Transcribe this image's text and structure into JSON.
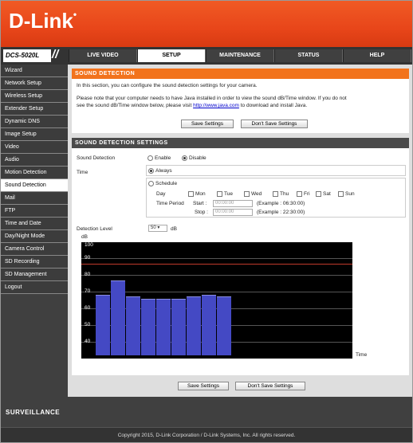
{
  "brand": {
    "logo": "D-Link",
    "model": "DCS-5020L",
    "footer_brand": "SURVEILLANCE"
  },
  "nav": {
    "tabs": [
      "LIVE VIDEO",
      "SETUP",
      "MAINTENANCE",
      "STATUS",
      "HELP"
    ],
    "active": "SETUP"
  },
  "sidebar": {
    "items": [
      "Wizard",
      "Network Setup",
      "Wireless Setup",
      "Extender Setup",
      "Dynamic DNS",
      "Image Setup",
      "Video",
      "Audio",
      "Motion Detection",
      "Sound Detection",
      "Mail",
      "FTP",
      "Time and Date",
      "Day/Night Mode",
      "Camera Control",
      "SD Recording",
      "SD Management",
      "Logout"
    ],
    "active": "Sound Detection"
  },
  "intro": {
    "title": "SOUND DETECTION",
    "line1": "In this section, you can configure the sound detection settings for your camera.",
    "line2": "Please note that your computer needs to have Java installed in order to view the sound dB/Time window. If you do not",
    "line3a": "see the sound dB/Time window below, please visit",
    "link": "http://www.java.com",
    "line3b": "to download and install Java.",
    "save": "Save Settings",
    "dont_save": "Don't Save Settings"
  },
  "settings": {
    "title": "SOUND DETECTION SETTINGS",
    "sd_label": "Sound Detection",
    "enable": "Enable",
    "disable": "Disable",
    "time_label": "Time",
    "always": "Always",
    "schedule": "Schedule",
    "day_label": "Day",
    "days": [
      "Mon",
      "Tue",
      "Wed",
      "Thu",
      "Fri",
      "Sat",
      "Sun"
    ],
    "time_period": "Time Period",
    "start": "Start :",
    "start_ph": "00:00:00",
    "start_ex": "(Example : 06:30:00)",
    "stop": "Stop :",
    "stop_ph": "00:00:00",
    "stop_ex": "(Example : 22:30:00)",
    "level_label": "Detection Level",
    "level_value": "50",
    "level_unit": "dB"
  },
  "chart_data": {
    "type": "bar",
    "ylabel": "dB",
    "xlabel": "Time",
    "ylim": [
      40,
      100
    ],
    "yticks": [
      "100",
      "90",
      "80",
      "70",
      "60",
      "50",
      "40"
    ],
    "threshold": 90,
    "values": [
      73,
      81,
      72,
      71,
      71,
      71,
      72,
      73,
      72
    ],
    "colors": {
      "bar": "#4449c4",
      "threshold": "#c0392b",
      "background": "#000000"
    }
  },
  "bottom": {
    "save": "Save Settings",
    "dont_save": "Don't Save Settings"
  },
  "copyright": "Copyright 2015, D-Link Corporation / D-Link Systems, Inc. All rights reserved."
}
